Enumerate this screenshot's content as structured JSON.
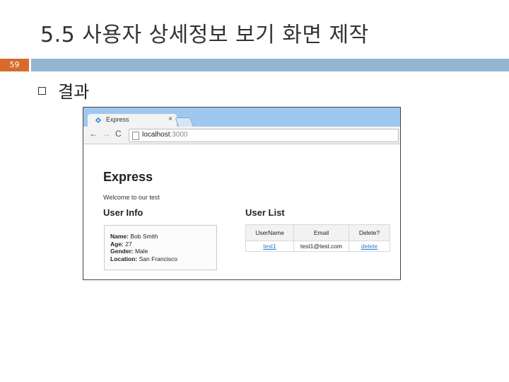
{
  "slide": {
    "title": "5.5 사용자 상세정보 보기 화면 제작",
    "number": "59",
    "bullet_text": "결과",
    "colors": {
      "bar": "#94b6d2",
      "number_bg": "#d86a2b"
    }
  },
  "browser": {
    "tab_title": "Express",
    "tab_close": "×",
    "address_host": "localhost",
    "address_port": ":3000",
    "nav": {
      "back": "←",
      "forward": "→",
      "reload": "C"
    }
  },
  "page": {
    "title": "Express",
    "subtitle": "Welcome to our test",
    "user_info": {
      "heading": "User Info",
      "name_label": "Name:",
      "name_value": "Bob Smith",
      "age_label": "Age:",
      "age_value": "27",
      "gender_label": "Gender:",
      "gender_value": "Male",
      "location_label": "Location:",
      "location_value": "San Francisco"
    },
    "user_list": {
      "heading": "User List",
      "columns": [
        "UserName",
        "Email",
        "Delete?"
      ],
      "rows": [
        {
          "username": "test1",
          "email": "test1@test.com",
          "delete": "delete"
        }
      ]
    }
  }
}
